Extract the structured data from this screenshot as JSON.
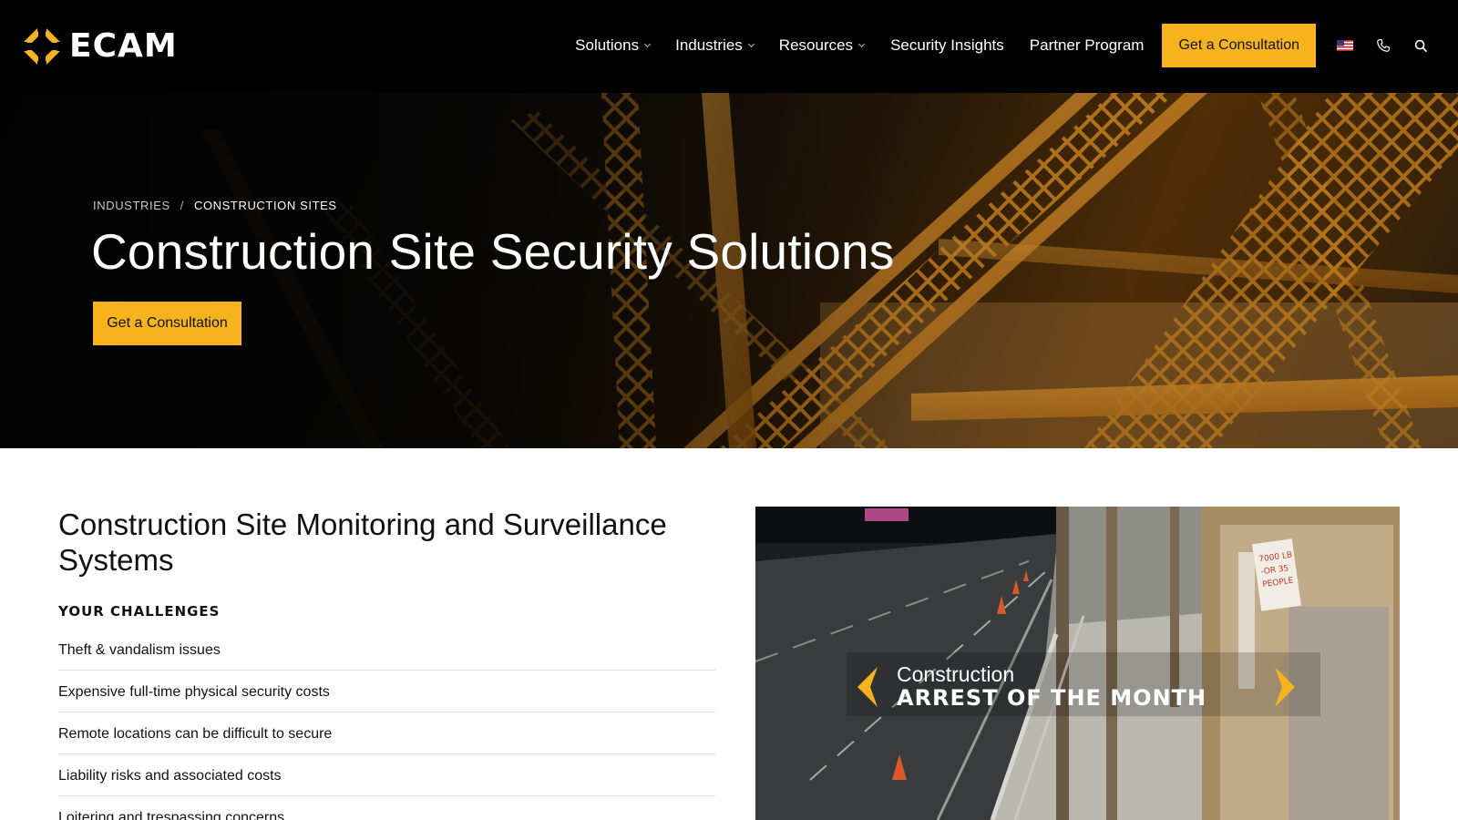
{
  "header": {
    "logo_text": "ECAM",
    "nav": [
      {
        "label": "Solutions",
        "dropdown": true
      },
      {
        "label": "Industries",
        "dropdown": true
      },
      {
        "label": "Resources",
        "dropdown": true
      },
      {
        "label": "Security Insights",
        "dropdown": false
      },
      {
        "label": "Partner Program",
        "dropdown": false
      }
    ],
    "cta_label": "Get a Consultation",
    "icons": [
      "us-flag-icon",
      "phone-icon",
      "search-icon"
    ]
  },
  "hero": {
    "breadcrumb": [
      "INDUSTRIES",
      "CONSTRUCTION SITES"
    ],
    "breadcrumb_separator": "/",
    "title": "Construction Site Security Solutions",
    "cta_label": "Get a Consultation"
  },
  "content": {
    "section_title": "Construction Site Monitoring and Surveillance Systems",
    "challenges_heading": "YOUR CHALLENGES",
    "challenges": [
      "Theft & vandalism issues",
      "Expensive full-time physical security costs",
      "Remote locations can be difficult to secure",
      "Liability risks and associated costs",
      "Loitering and trespassing concerns"
    ]
  },
  "video": {
    "caption_line1": "Construction",
    "caption_line2": "ARREST OF THE MONTH",
    "sign_text": [
      "7000 LB",
      "-OR 35",
      "PEOPLE"
    ]
  },
  "colors": {
    "accent": "#f6b31e",
    "header_bg": "#000000"
  }
}
